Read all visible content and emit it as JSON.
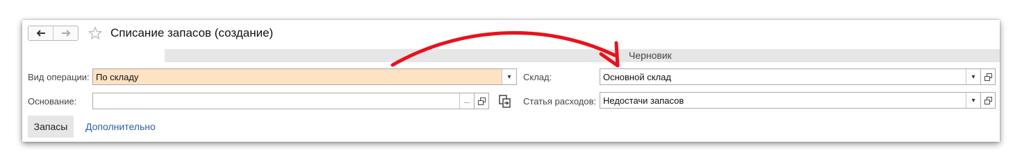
{
  "header": {
    "title": "Списание запасов (создание)",
    "back_icon": "arrow-left-icon",
    "forward_icon": "arrow-right-icon",
    "favorite_icon": "star-icon"
  },
  "status": {
    "label": "Черновик"
  },
  "form": {
    "operation_type": {
      "label": "Вид операции:",
      "value": "По складу",
      "dropdown_glyph": "▾"
    },
    "basis": {
      "label": "Основание:",
      "value": "",
      "select_glyph": "..."
    },
    "warehouse": {
      "label": "Склад:",
      "value": "Основной склад",
      "dropdown_glyph": "▾"
    },
    "expense_item": {
      "label": "Статья расходов:",
      "value": "Недостачи запасов",
      "dropdown_glyph": "▾"
    }
  },
  "tabs": [
    {
      "label": "Запасы",
      "active": true
    },
    {
      "label": "Дополнительно",
      "active": false
    }
  ],
  "annotation": {
    "color": "#e8121b"
  },
  "colors": {
    "highlight_field": "#fde2c4",
    "link": "#2a5db0",
    "strip": "#e6e6e6"
  }
}
